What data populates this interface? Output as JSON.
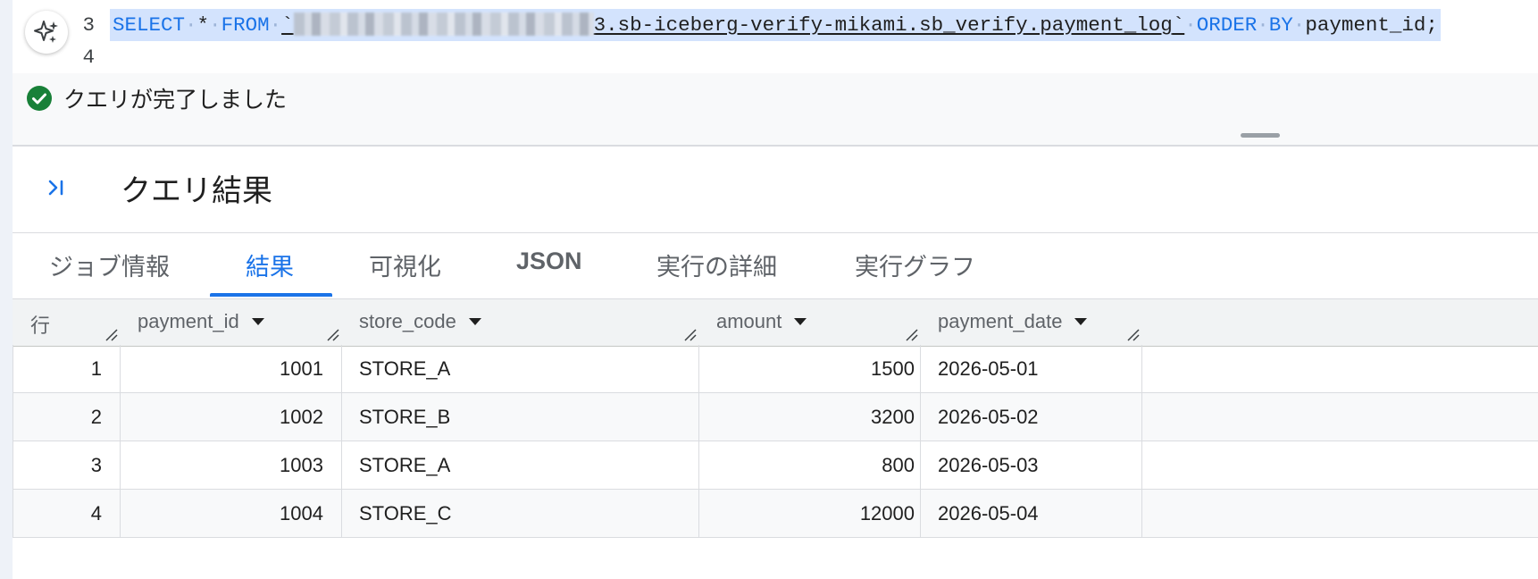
{
  "editor": {
    "lines": [
      {
        "number": "3",
        "tokens": {
          "select": "SELECT",
          "star": "*",
          "from": "FROM",
          "table_suffix": "3.sb-iceberg-verify-mikami.sb_verify.payment_log",
          "order": "ORDER",
          "by": "BY",
          "column": "payment_id;"
        }
      },
      {
        "number": "4"
      }
    ],
    "ai_button_icon": "sparkle-icon"
  },
  "status": {
    "text": "クエリが完了しました",
    "icon": "check-circle-icon",
    "color": "#188038"
  },
  "results": {
    "title": "クエリ結果",
    "tabs": [
      "ジョブ情報",
      "結果",
      "可視化",
      "JSON",
      "実行の詳細",
      "実行グラフ"
    ],
    "active_tab": "結果",
    "columns": [
      "行",
      "payment_id",
      "store_code",
      "amount",
      "payment_date"
    ],
    "rows": [
      {
        "row": "1",
        "payment_id": "1001",
        "store_code": "STORE_A",
        "amount": "1500",
        "payment_date": "2026-05-01"
      },
      {
        "row": "2",
        "payment_id": "1002",
        "store_code": "STORE_B",
        "amount": "3200",
        "payment_date": "2026-05-02"
      },
      {
        "row": "3",
        "payment_id": "1003",
        "store_code": "STORE_A",
        "amount": "800",
        "payment_date": "2026-05-03"
      },
      {
        "row": "4",
        "payment_id": "1004",
        "store_code": "STORE_C",
        "amount": "12000",
        "payment_date": "2026-05-04"
      }
    ]
  },
  "colors": {
    "accent": "#1a73e8",
    "selection": "#d3e3fd"
  }
}
